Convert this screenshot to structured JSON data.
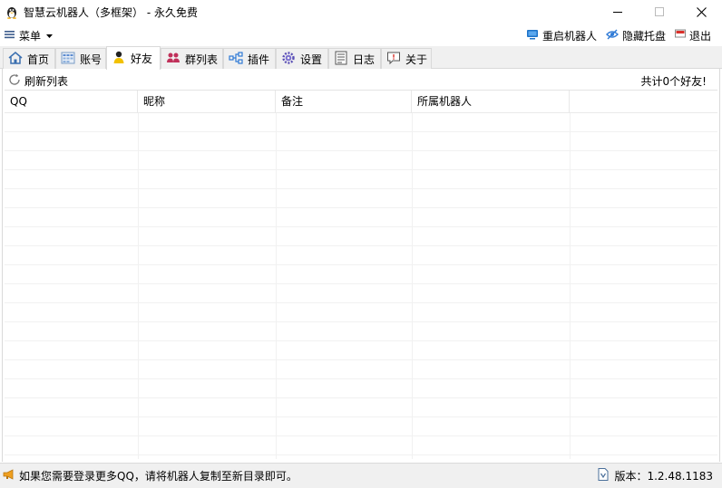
{
  "window": {
    "title": "智慧云机器人（多框架） - 永久免费",
    "controls": {
      "minimize": "minimize-icon",
      "maximize": "maximize-icon",
      "close": "close-icon"
    }
  },
  "menubar": {
    "menu_label": "菜单",
    "restart_label": "重启机器人",
    "hide_tray_label": "隐藏托盘",
    "exit_label": "退出"
  },
  "tabs": [
    {
      "label": "首页",
      "icon": "home-icon"
    },
    {
      "label": "账号",
      "icon": "account-icon"
    },
    {
      "label": "好友",
      "icon": "friend-icon",
      "active": true
    },
    {
      "label": "群列表",
      "icon": "group-icon"
    },
    {
      "label": "插件",
      "icon": "plugin-icon"
    },
    {
      "label": "设置",
      "icon": "settings-icon"
    },
    {
      "label": "日志",
      "icon": "log-icon"
    },
    {
      "label": "关于",
      "icon": "about-icon"
    }
  ],
  "friends_panel": {
    "refresh_label": "刷新列表",
    "count_text": "共计0个好友!",
    "columns": [
      "QQ",
      "昵称",
      "备注",
      "所属机器人"
    ],
    "rows": []
  },
  "statusbar": {
    "notice": "如果您需要登录更多QQ，请将机器人复制至新目录即可。",
    "version": "版本：1.2.48.1183"
  },
  "colors": {
    "tab_strip_bg": "#f0f0f0",
    "accent_blue": "#2f7ad6",
    "restart_icon_blue": "#1e73c8",
    "exit_icon_red": "#d9302a",
    "notice_icon_orange": "#f0a020"
  }
}
